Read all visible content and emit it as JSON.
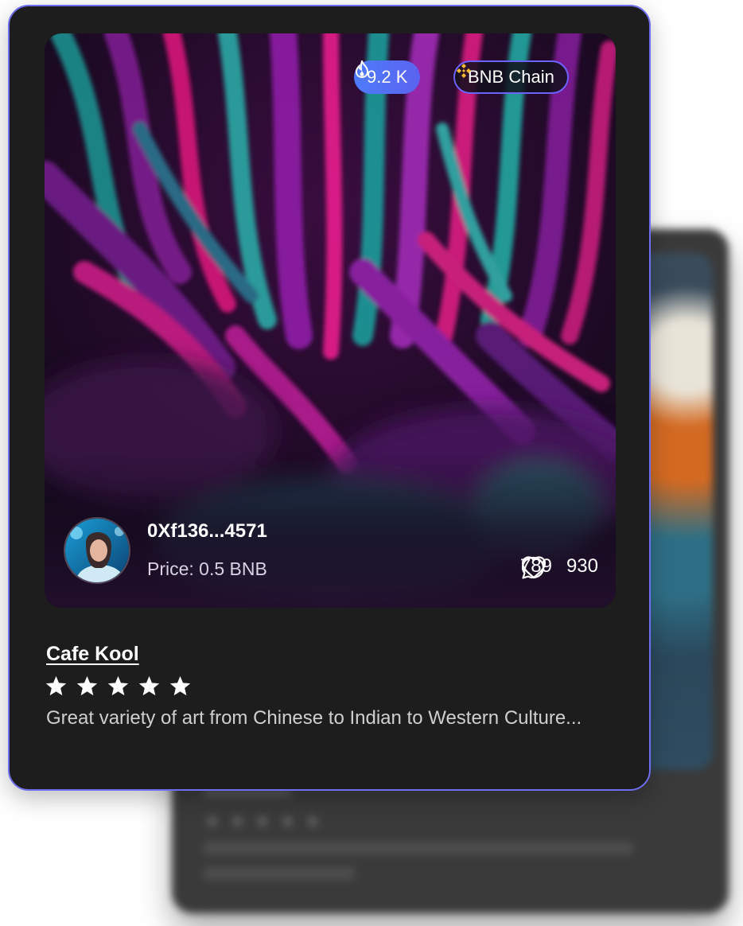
{
  "card": {
    "views_badge": "9.2 K",
    "chain_badge": "BNB Chain",
    "owner_address": "0Xf136...4571",
    "price": "Price: 0.5 BNB",
    "likes": "789",
    "comments": "930",
    "title": "Cafe Kool",
    "rating": 5,
    "description": "Great variety of art from Chinese to Indian to Western Culture..."
  },
  "colors": {
    "card_bg": "#1d1d1e",
    "card_border": "#6e6ef0",
    "views_badge": "#5b63ef",
    "chain_badge_border": "#6c63ff",
    "bnb_yellow": "#f3ba2f"
  },
  "icons": [
    "fire-icon",
    "bnb-logo-icon",
    "heart-icon",
    "comment-icon",
    "star-icon"
  ]
}
